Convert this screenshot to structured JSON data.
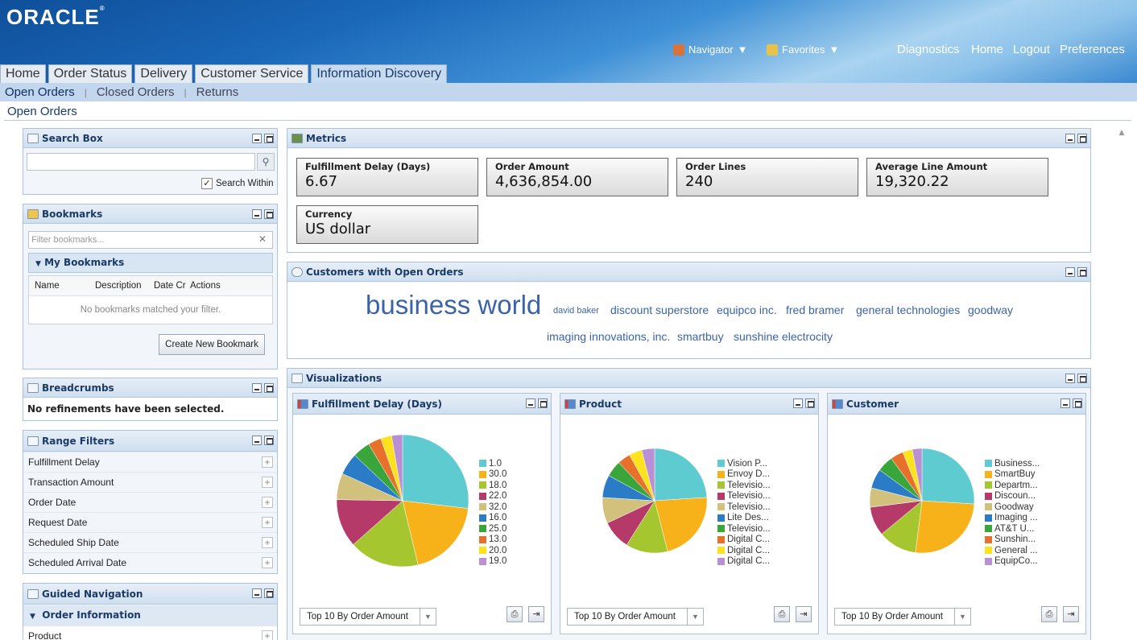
{
  "brand": "ORACLE",
  "global_nav": {
    "navigator": "Navigator",
    "favorites": "Favorites",
    "links": [
      "Diagnostics",
      "Home",
      "Logout",
      "Preferences"
    ]
  },
  "tabs": [
    "Home",
    "Order Status",
    "Delivery",
    "Customer Service",
    "Information Discovery"
  ],
  "subnav": [
    "Open Orders",
    "Closed Orders",
    "Returns"
  ],
  "page_title": "Open Orders",
  "search": {
    "title": "Search Box",
    "search_within": "Search Within"
  },
  "bookmarks": {
    "title": "Bookmarks",
    "filter_placeholder": "Filter bookmarks...",
    "group": "My Bookmarks",
    "columns": [
      "Name",
      "Description",
      "Date Cr",
      "Actions"
    ],
    "empty": "No bookmarks matched your filter.",
    "create": "Create New Bookmark"
  },
  "breadcrumbs": {
    "title": "Breadcrumbs",
    "text": "No refinements have been selected."
  },
  "range_filters": {
    "title": "Range Filters",
    "items": [
      "Fulfillment Delay",
      "Transaction Amount",
      "Order Date",
      "Request Date",
      "Scheduled Ship Date",
      "Scheduled Arrival Date"
    ]
  },
  "guided_nav": {
    "title": "Guided Navigation",
    "group": "Order Information",
    "items": [
      "Product"
    ]
  },
  "metrics": {
    "title": "Metrics",
    "items": [
      {
        "label": "Fulfillment Delay (Days)",
        "value": "6.67"
      },
      {
        "label": "Order Amount",
        "value": "4,636,854.00"
      },
      {
        "label": "Order Lines",
        "value": "240"
      },
      {
        "label": "Average Line Amount",
        "value": "19,320.22"
      },
      {
        "label": "Currency",
        "value": "US dollar"
      }
    ]
  },
  "customers": {
    "title": "Customers with Open Orders",
    "words": [
      "business world",
      "david baker",
      "discount superstore",
      "equipco inc.",
      "fred bramer",
      "general technologies",
      "goodway",
      "imaging innovations, inc.",
      "smartbuy",
      "sunshine electrocity"
    ]
  },
  "visualizations": {
    "title": "Visualizations",
    "colors": [
      "#5ecbd0",
      "#f7b21a",
      "#a6c62f",
      "#b53a6a",
      "#d2c07d",
      "#2a7cc7",
      "#3aa53b",
      "#e7702b",
      "#fde21e",
      "#b98fd6"
    ],
    "charts": [
      {
        "title": "Fulfillment Delay (Days)",
        "legend": [
          "1.0",
          "30.0",
          "18.0",
          "22.0",
          "32.0",
          "16.0",
          "25.0",
          "13.0",
          "20.0",
          "19.0"
        ],
        "values": [
          25,
          18,
          16,
          11,
          6,
          5,
          4,
          3,
          2.5,
          2.5
        ],
        "select": "Top 10 By Order Amount"
      },
      {
        "title": "Product",
        "legend": [
          "Vision P...",
          "Envoy D...",
          "Televisio...",
          "Televisio...",
          "Televisio...",
          "Lite Des...",
          "Televisio...",
          "Digital C...",
          "Digital C...",
          "Digital C..."
        ],
        "values": [
          24,
          22,
          13,
          9,
          8,
          7,
          5,
          4,
          4,
          4
        ],
        "select": "Top 10 By Order Amount"
      },
      {
        "title": "Customer",
        "legend": [
          "Business...",
          "SmartBuy",
          "Departm...",
          "Discoun...",
          "Goodway",
          "Imaging ...",
          "AT&T U...",
          "Sunshin...",
          "General ...",
          "EquipCo..."
        ],
        "values": [
          26,
          26,
          12,
          9,
          6,
          6,
          5,
          4,
          3,
          3
        ],
        "select": "Top 10 By Order Amount"
      }
    ]
  }
}
